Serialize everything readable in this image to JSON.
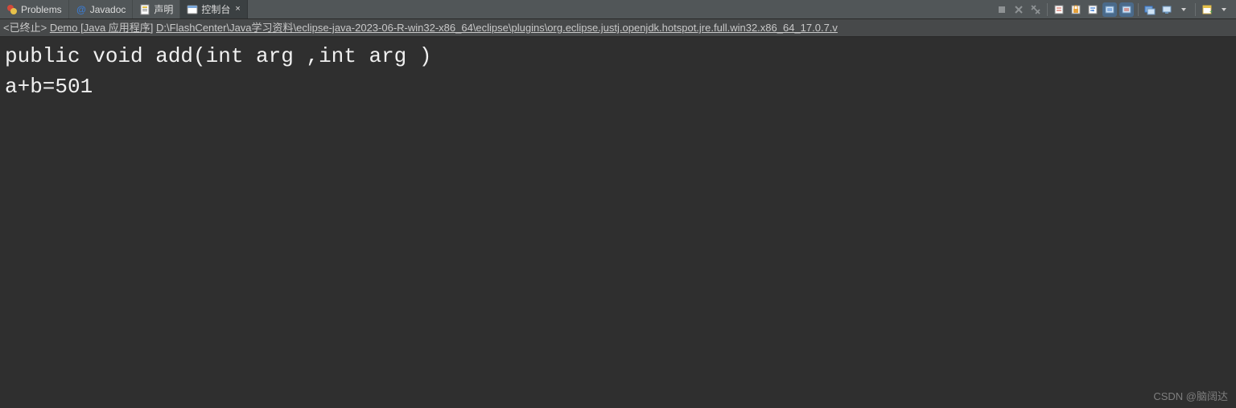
{
  "tabs": [
    {
      "label": "Problems",
      "icon_color_a": "#d24a3a",
      "icon_color_b": "#e6c14a",
      "active": false
    },
    {
      "label": "Javadoc",
      "at_color": "#3b7bd1",
      "active": false
    },
    {
      "label": "声明",
      "doc_color": "#e6c14a",
      "active": false
    },
    {
      "label": "控制台",
      "doc_color": "#7aa7d9",
      "active": true,
      "closable": true
    }
  ],
  "close_glyph": "×",
  "description": {
    "status": "<已终止>",
    "name": "Demo [Java 应用程序]",
    "path": "D:\\FlashCenter\\Java学习资料\\eclipse-java-2023-06-R-win32-x86_64\\eclipse\\plugins\\org.eclipse.justj.openjdk.hotspot.jre.full.win32.x86_64_17.0.7.v"
  },
  "output": {
    "line1": "public void add(int arg ,int arg )",
    "line2": "a+b=501"
  },
  "watermark": "CSDN @脑阔达",
  "icons": {
    "stop": "■",
    "close_all": "✕✕",
    "remove": "✕",
    "remove_all": "🗑",
    "clear": "🧹",
    "scroll_lock": "🔒",
    "word_wrap": "↩",
    "pin": "📌",
    "display": "🖥",
    "display2": "🖳",
    "drop": "▾",
    "new_console": "📄"
  }
}
